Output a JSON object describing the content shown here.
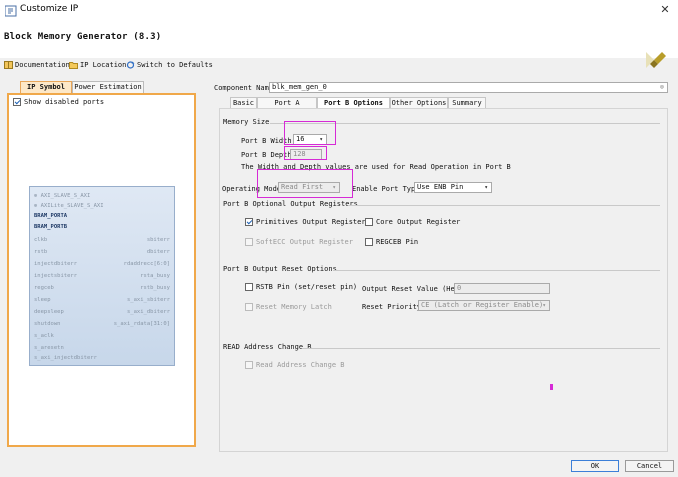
{
  "window": {
    "title": "Customize IP",
    "close_glyph": "✕"
  },
  "header": {
    "ip_name": "Block Memory Generator (8.3)",
    "logo_icon": "xilinx-logo-icon"
  },
  "toolbar": {
    "documentation": "Documentation",
    "ip_location": "IP Location",
    "switch_defaults": "Switch to Defaults"
  },
  "left": {
    "tabs": [
      "IP Symbol",
      "Power Estimation"
    ],
    "show_disabled_ports": "Show disabled ports",
    "symbol": {
      "left_pins": [
        "AXI_SLAVE_S_AXI",
        "BRAM_PORTA",
        "BRAM_PORTB",
        "clkb",
        "rstb",
        "s_aclk",
        "s_aresetn"
      ],
      "right_pins": [
        "rsta_busy",
        "rstb_busy",
        "s_axi_rdata[31:0]"
      ]
    }
  },
  "right": {
    "component_name_label": "Component Name",
    "component_name_value": "blk_mem_gen_0",
    "tabs": [
      "Basic",
      "Port A Options",
      "Port B Options",
      "Other Options",
      "Summary"
    ],
    "memory_size": {
      "title": "Memory Size",
      "port_b_width_label": "Port B Width",
      "port_b_width_value": "16",
      "port_b_depth_label": "Port B Depth",
      "port_b_depth_value": "128",
      "note": "The Width and Depth values are used for Read Operation in Port B"
    },
    "operating_mode_label": "Operating Mode",
    "operating_mode_value": "Read First",
    "enable_port_type_label": "Enable Port Type",
    "enable_port_type_value": "Use ENB Pin",
    "optional_registers": {
      "title": "Port B Optional Output Registers",
      "primitives": "Primitives Output Register",
      "core": "Core Output Register",
      "softecc": "SoftECC Output Register",
      "regceb": "REGCEB Pin"
    },
    "reset_options": {
      "title": "Port B Output Reset Options",
      "rstb_pin": "RSTB Pin (set/reset pin)",
      "output_reset_value_label": "Output Reset Value (Hex)",
      "output_reset_value": "0",
      "reset_memory_latch": "Reset Memory Latch",
      "reset_priority_label": "Reset Priority",
      "reset_priority_value": "CE (Latch or Register Enable)"
    },
    "read_address": {
      "title": "READ Address Change B",
      "checkbox": "Read Address Change B"
    }
  },
  "buttons": {
    "ok": "OK",
    "cancel": "Cancel"
  },
  "colors": {
    "highlight": "#d62ad6",
    "symbol_panel_border": "#f0a84a",
    "tab_active": "#fde8c8"
  }
}
